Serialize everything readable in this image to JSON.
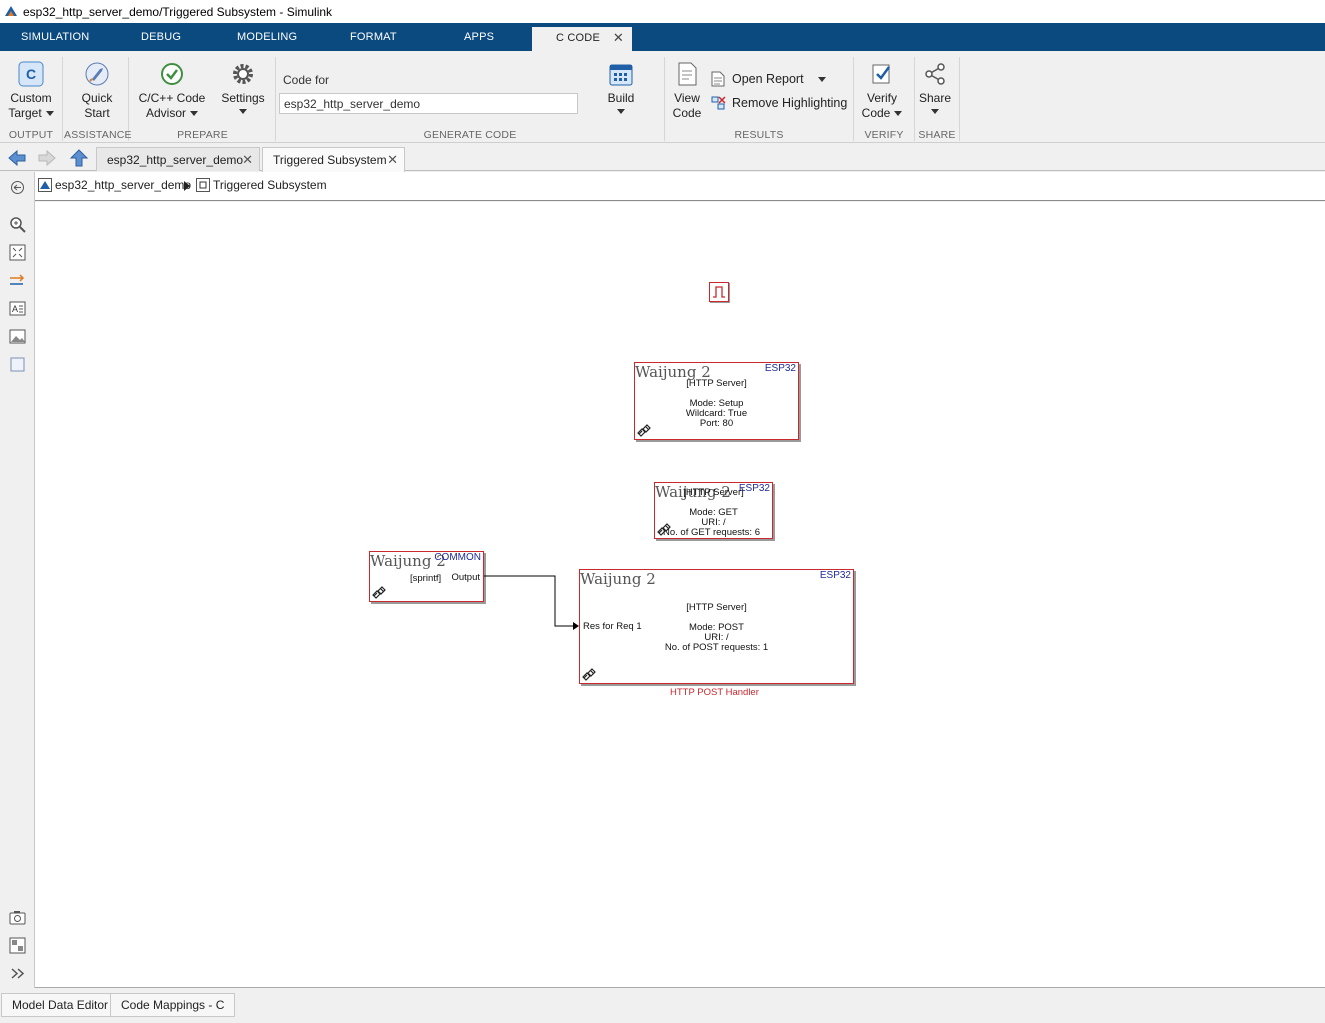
{
  "window": {
    "title": "esp32_http_server_demo/Triggered Subsystem - Simulink"
  },
  "menu": {
    "tabs": [
      "SIMULATION",
      "DEBUG",
      "MODELING",
      "FORMAT",
      "APPS",
      "C CODE"
    ],
    "active": "C CODE"
  },
  "toolstrip": {
    "custom_target": {
      "line1": "Custom",
      "line2": "Target"
    },
    "quick_start": {
      "line1": "Quick",
      "line2": "Start"
    },
    "code_advisor": {
      "line1": "C/C++ Code",
      "line2": "Advisor"
    },
    "settings": {
      "label": "Settings"
    },
    "code_for": {
      "label": "Code for",
      "value": "esp32_http_server_demo"
    },
    "build": {
      "label": "Build"
    },
    "view_code": {
      "line1": "View",
      "line2": "Code"
    },
    "open_report": {
      "label": "Open Report"
    },
    "remove_highlighting": {
      "label": "Remove Highlighting"
    },
    "verify_code": {
      "line1": "Verify",
      "line2": "Code"
    },
    "share": {
      "label": "Share"
    },
    "sections": {
      "output": "OUTPUT",
      "assistance": "ASSISTANCE",
      "prepare": "PREPARE",
      "generate_code": "GENERATE CODE",
      "results": "RESULTS",
      "verify": "VERIFY",
      "share": "SHARE"
    }
  },
  "tabs": {
    "model": "esp32_http_server_demo",
    "subsystem": "Triggered Subsystem"
  },
  "breadcrumb": {
    "root": "esp32_http_server_demo",
    "current": "Triggered Subsystem"
  },
  "blocks": {
    "logo_text": "Waijung 2",
    "setup": {
      "tag": "ESP32",
      "lines": [
        "[HTTP Server]",
        "",
        "Mode: Setup",
        "Wildcard: True",
        "Port: 80"
      ]
    },
    "get": {
      "tag": "ESP32",
      "lines": [
        "[HTTP Server]",
        "",
        "Mode: GET",
        "URI: /",
        "No. of GET requests: 6"
      ]
    },
    "sprintf": {
      "tag": "COMMON",
      "label": "[sprintf]",
      "port_out": "Output"
    },
    "post": {
      "tag": "ESP32",
      "lines": [
        "[HTTP Server]",
        "",
        "Mode: POST",
        "URI: /",
        "No. of POST requests: 1"
      ],
      "port_in": "Res for Req 1",
      "caption": "HTTP POST Handler"
    }
  },
  "bottom": {
    "tab1": "Model Data Editor",
    "tab2": "Code Mappings - C"
  }
}
